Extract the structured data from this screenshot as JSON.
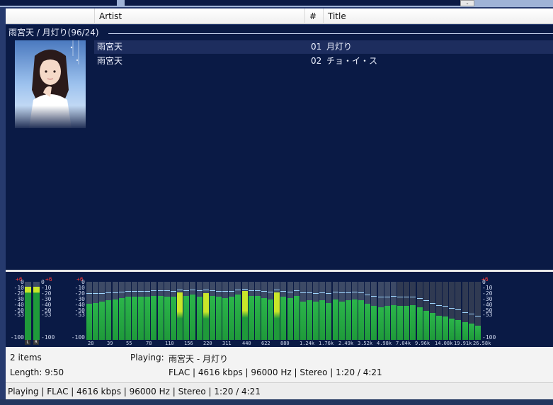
{
  "columns": {
    "artist": "Artist",
    "number": "#",
    "title": "Title"
  },
  "group": {
    "header": "雨宮天 / 月灯り(96/24)"
  },
  "tracks": [
    {
      "artist": "雨宮天",
      "number": "01",
      "title": "月灯り",
      "selected": true
    },
    {
      "artist": "雨宮天",
      "number": "02",
      "title": "チョ・イ・ス",
      "selected": false
    }
  ],
  "visualizer": {
    "vu": {
      "labels": [
        "0",
        "-10",
        "-20",
        "-30",
        "-40",
        "-50",
        "-53",
        "-100"
      ],
      "top_label": "+6",
      "left_tag": "L",
      "right_tag": "R",
      "left_level": 0.92,
      "right_level": 0.92
    },
    "spectrum": {
      "labels": [
        "0",
        "-10",
        "-20",
        "-30",
        "-40",
        "-50",
        "-53",
        "-100"
      ],
      "top_label": "+6",
      "freq_labels": [
        "28",
        "39",
        "55",
        "78",
        "110",
        "156",
        "220",
        "311",
        "440",
        "622",
        "880",
        "1.24k",
        "1.76k",
        "2.49k",
        "3.52k",
        "4.98k",
        "7.04k",
        "9.96k",
        "14.08k",
        "19.91k",
        "26.58k"
      ],
      "levels": [
        0.62,
        0.64,
        0.66,
        0.68,
        0.7,
        0.72,
        0.74,
        0.74,
        0.75,
        0.75,
        0.76,
        0.76,
        0.75,
        0.74,
        0.82,
        0.76,
        0.78,
        0.74,
        0.8,
        0.76,
        0.74,
        0.72,
        0.74,
        0.78,
        0.84,
        0.76,
        0.76,
        0.72,
        0.7,
        0.82,
        0.74,
        0.72,
        0.76,
        0.66,
        0.68,
        0.66,
        0.68,
        0.64,
        0.7,
        0.66,
        0.68,
        0.7,
        0.68,
        0.62,
        0.58,
        0.56,
        0.58,
        0.6,
        0.58,
        0.58,
        0.6,
        0.56,
        0.5,
        0.46,
        0.42,
        0.4,
        0.36,
        0.34,
        0.3,
        0.28,
        0.24
      ],
      "peaks": [
        0.8,
        0.8,
        0.81,
        0.82,
        0.82,
        0.83,
        0.84,
        0.84,
        0.84,
        0.84,
        0.85,
        0.85,
        0.85,
        0.84,
        0.86,
        0.85,
        0.86,
        0.85,
        0.86,
        0.85,
        0.84,
        0.84,
        0.84,
        0.86,
        0.88,
        0.85,
        0.85,
        0.84,
        0.83,
        0.86,
        0.84,
        0.83,
        0.85,
        0.82,
        0.82,
        0.81,
        0.82,
        0.8,
        0.83,
        0.82,
        0.82,
        0.83,
        0.82,
        0.78,
        0.76,
        0.74,
        0.75,
        0.76,
        0.74,
        0.74,
        0.75,
        0.72,
        0.68,
        0.64,
        0.6,
        0.58,
        0.55,
        0.52,
        0.48,
        0.45,
        0.42
      ]
    }
  },
  "info": {
    "items": "2 items",
    "length": "Length: 9:50",
    "playing_label": "Playing:",
    "playing_value": "雨宮天 - 月灯り",
    "format": "FLAC | 4616 kbps | 96000 Hz | Stereo | 1:20 / 4:21"
  },
  "status_bar": {
    "text": "Playing | FLAC | 4616 kbps | 96000 Hz | Stereo | 1:20 / 4:21"
  },
  "colors": {
    "playlist_bg": "#0a1a45",
    "selected_row": "#1d2d5e",
    "bar_green": "#1f9a3a",
    "bar_yellow": "#c9e62a"
  }
}
